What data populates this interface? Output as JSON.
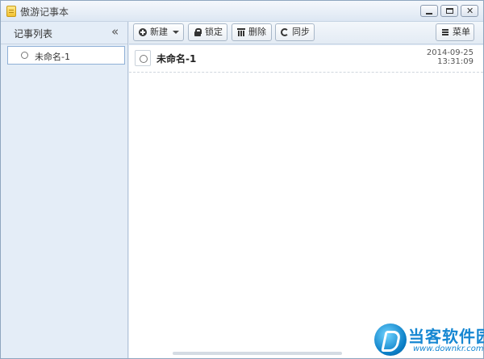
{
  "window": {
    "title": "傲游记事本"
  },
  "sidebar": {
    "title": "记事列表",
    "collapse_icon": "«",
    "items": [
      {
        "label": "未命名-1"
      }
    ]
  },
  "toolbar": {
    "new_label": "新建",
    "lock_label": "锁定",
    "delete_label": "删除",
    "sync_label": "同步",
    "menu_label": "菜单"
  },
  "notes": [
    {
      "title": "未命名-1",
      "date": "2014-09-25",
      "time": "13:31:09"
    }
  ],
  "watermark": {
    "name": "当客软件园",
    "url": "www.downkr.com"
  },
  "colors": {
    "sidebar_bg": "#e4edf7",
    "accent": "#1687d2"
  }
}
